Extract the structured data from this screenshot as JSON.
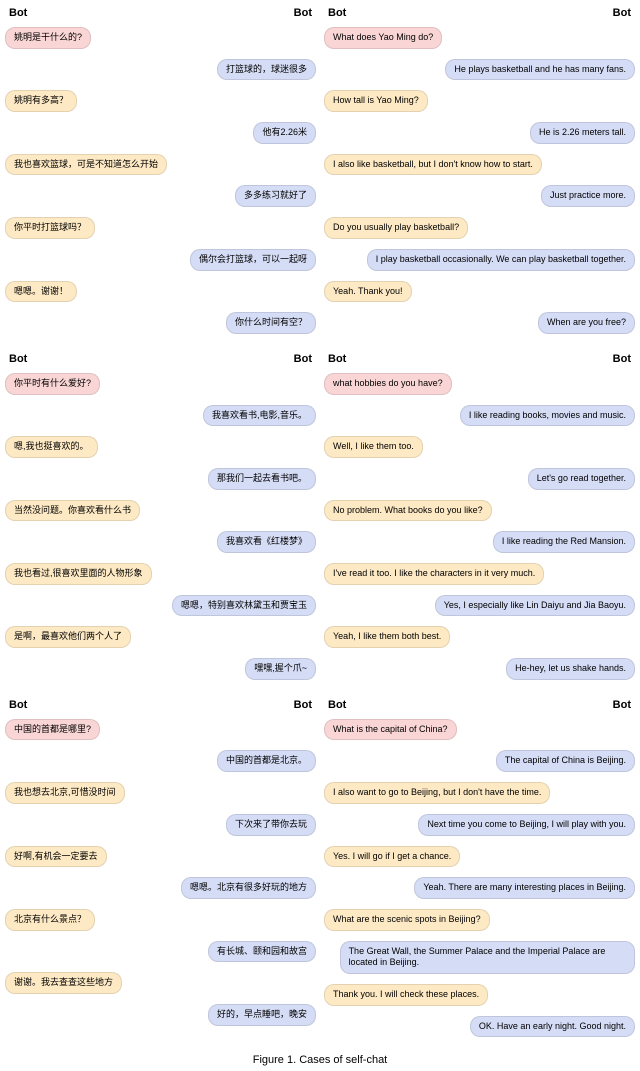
{
  "headers": {
    "bot_left": "Bot",
    "bot_right": "Bot"
  },
  "caption": "Figure 1. Cases of self-chat",
  "sections": [
    {
      "left": [
        {
          "side": "left",
          "color": "pink",
          "text": "姚明是干什么的?"
        },
        {
          "side": "right",
          "color": "blue",
          "text": "打篮球的，球迷很多"
        },
        {
          "side": "left",
          "color": "yellow",
          "text": "姚明有多高？"
        },
        {
          "side": "right",
          "color": "blue",
          "text": "他有2.26米"
        },
        {
          "side": "left",
          "color": "yellow",
          "text": "我也喜欢篮球，可是不知道怎么开始"
        },
        {
          "side": "right",
          "color": "blue",
          "text": "多多练习就好了"
        },
        {
          "side": "left",
          "color": "yellow",
          "text": "你平时打篮球吗？"
        },
        {
          "side": "right",
          "color": "blue",
          "text": "偶尔会打篮球，可以一起呀"
        },
        {
          "side": "left",
          "color": "yellow",
          "text": "嗯嗯。谢谢！"
        },
        {
          "side": "right",
          "color": "blue",
          "text": "你什么时间有空？"
        }
      ],
      "right": [
        {
          "side": "left",
          "color": "pink",
          "text": "What does Yao Ming do?"
        },
        {
          "side": "right",
          "color": "blue",
          "text": "He plays basketball and he has many fans."
        },
        {
          "side": "left",
          "color": "yellow",
          "text": "How tall is Yao Ming?"
        },
        {
          "side": "right",
          "color": "blue",
          "text": "He is 2.26 meters tall."
        },
        {
          "side": "left",
          "color": "yellow",
          "text": "I also like basketball, but I don't know how to start."
        },
        {
          "side": "right",
          "color": "blue",
          "text": "Just practice more."
        },
        {
          "side": "left",
          "color": "yellow",
          "text": "Do you usually play basketball?"
        },
        {
          "side": "right",
          "color": "blue",
          "text": "I play basketball occasionally. We can play basketball together."
        },
        {
          "side": "left",
          "color": "yellow",
          "text": "Yeah. Thank you!"
        },
        {
          "side": "right",
          "color": "blue",
          "text": "When are you free?"
        }
      ]
    },
    {
      "left": [
        {
          "side": "left",
          "color": "pink",
          "text": "你平时有什么爱好?"
        },
        {
          "side": "right",
          "color": "blue",
          "text": "我喜欢看书,电影,音乐。"
        },
        {
          "side": "left",
          "color": "yellow",
          "text": "嗯,我也挺喜欢的。"
        },
        {
          "side": "right",
          "color": "blue",
          "text": "那我们一起去看书吧。"
        },
        {
          "side": "left",
          "color": "yellow",
          "text": "当然没问题。你喜欢看什么书"
        },
        {
          "side": "right",
          "color": "blue",
          "text": "我喜欢看《红楼梦》"
        },
        {
          "side": "left",
          "color": "yellow",
          "text": "我也看过,很喜欢里面的人物形象"
        },
        {
          "side": "right",
          "color": "blue",
          "text": "嗯嗯，特别喜欢林黛玉和贾宝玉"
        },
        {
          "side": "left",
          "color": "yellow",
          "text": "是啊，最喜欢他们两个人了"
        },
        {
          "side": "right",
          "color": "blue",
          "text": "嘿嘿,握个爪~"
        }
      ],
      "right": [
        {
          "side": "left",
          "color": "pink",
          "text": "what hobbies do you have?"
        },
        {
          "side": "right",
          "color": "blue",
          "text": "I like reading books, movies and music."
        },
        {
          "side": "left",
          "color": "yellow",
          "text": "Well, I like them too."
        },
        {
          "side": "right",
          "color": "blue",
          "text": "Let's go read together."
        },
        {
          "side": "left",
          "color": "yellow",
          "text": "No problem. What books do you like?"
        },
        {
          "side": "right",
          "color": "blue",
          "text": "I like reading the Red Mansion."
        },
        {
          "side": "left",
          "color": "yellow",
          "text": "I've read it too. I like the characters in it very much."
        },
        {
          "side": "right",
          "color": "blue",
          "text": "Yes, I especially like Lin Daiyu and Jia Baoyu."
        },
        {
          "side": "left",
          "color": "yellow",
          "text": "Yeah, I like them both best."
        },
        {
          "side": "right",
          "color": "blue",
          "text": "He-hey, let us shake hands."
        }
      ]
    },
    {
      "left": [
        {
          "side": "left",
          "color": "pink",
          "text": "中国的首都是哪里?"
        },
        {
          "side": "right",
          "color": "blue",
          "text": "中国的首都是北京。"
        },
        {
          "side": "left",
          "color": "yellow",
          "text": "我也想去北京,可惜没时间"
        },
        {
          "side": "right",
          "color": "blue",
          "text": "下次来了带你去玩"
        },
        {
          "side": "left",
          "color": "yellow",
          "text": "好啊,有机会一定要去"
        },
        {
          "side": "right",
          "color": "blue",
          "text": "嗯嗯。北京有很多好玩的地方"
        },
        {
          "side": "left",
          "color": "yellow",
          "text": "北京有什么景点？"
        },
        {
          "side": "right",
          "color": "blue",
          "text": "有长城、颐和园和故宫"
        },
        {
          "side": "left",
          "color": "yellow",
          "text": "谢谢。我去查查这些地方"
        },
        {
          "side": "right",
          "color": "blue",
          "text": "好的，早点睡吧，晚安"
        }
      ],
      "right": [
        {
          "side": "left",
          "color": "pink",
          "text": "What is the capital of China?"
        },
        {
          "side": "right",
          "color": "blue",
          "text": "The capital of China is Beijing."
        },
        {
          "side": "left",
          "color": "yellow",
          "text": "I also want to go to Beijing, but I don't have the time."
        },
        {
          "side": "right",
          "color": "blue",
          "text": "Next time you come to Beijing, I will play with you."
        },
        {
          "side": "left",
          "color": "yellow",
          "text": "Yes. I will go if I get a chance."
        },
        {
          "side": "right",
          "color": "blue",
          "text": "Yeah. There are many interesting places in Beijing."
        },
        {
          "side": "left",
          "color": "yellow",
          "text": "What are the scenic spots in Beijing?"
        },
        {
          "side": "right",
          "color": "blue",
          "text": "The Great Wall, the Summer Palace and the Imperial Palace are located in Beijing."
        },
        {
          "side": "left",
          "color": "yellow",
          "text": "Thank you. I will check these places."
        },
        {
          "side": "right",
          "color": "blue",
          "text": "OK. Have an early night. Good night."
        }
      ]
    }
  ]
}
